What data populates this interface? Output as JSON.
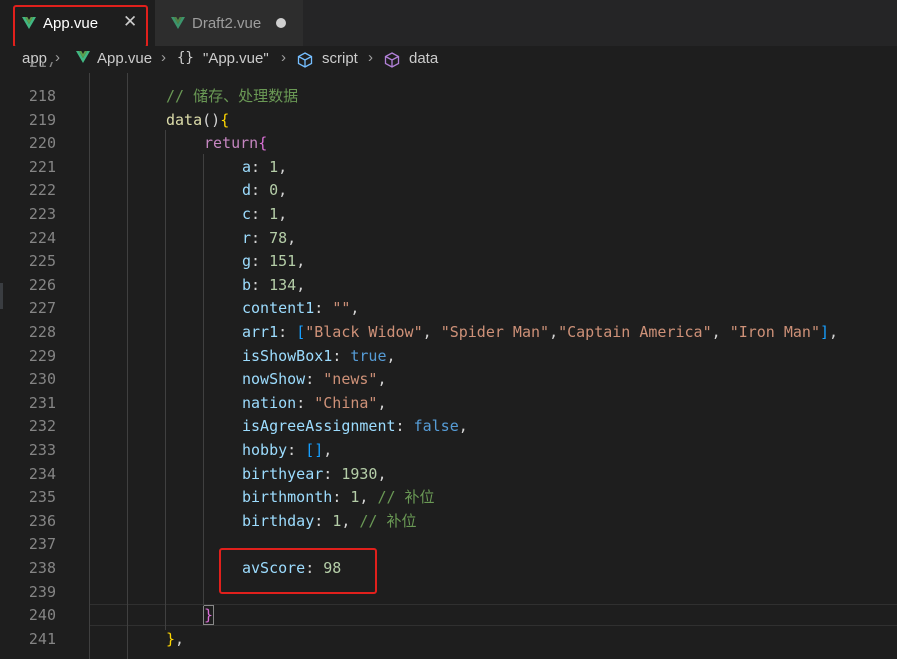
{
  "tabs": [
    {
      "label": "App.vue",
      "icon": "vue-icon",
      "active": true,
      "close_glyph": "✕"
    },
    {
      "label": "Draft2.vue",
      "icon": "vue-icon",
      "active": false,
      "unsaved": true
    }
  ],
  "breadcrumb": {
    "root": "app",
    "file": "App.vue",
    "braces": "{}",
    "object": "\"App.vue\"",
    "section": "script",
    "member": "data"
  },
  "editor": {
    "first_partial_line": "217",
    "lines": [
      {
        "n": "218",
        "comment": "// 储存、处理数据"
      },
      {
        "n": "219",
        "fn": "data",
        "paren": "()",
        "brace": "{"
      },
      {
        "n": "220",
        "kw": "return",
        "brace": "{"
      },
      {
        "n": "221",
        "key": "a",
        "val": "1",
        "type": "num"
      },
      {
        "n": "222",
        "key": "d",
        "val": "0",
        "type": "num"
      },
      {
        "n": "223",
        "key": "c",
        "val": "1",
        "type": "num"
      },
      {
        "n": "224",
        "key": "r",
        "val": "78",
        "type": "num"
      },
      {
        "n": "225",
        "key": "g",
        "val": "151",
        "type": "num"
      },
      {
        "n": "226",
        "key": "b",
        "val": "134",
        "type": "num"
      },
      {
        "n": "227",
        "key": "content1",
        "val": "\"\"",
        "type": "str"
      },
      {
        "n": "228",
        "key": "arr1",
        "items": [
          "\"Black Widow\"",
          "\"Spider Man\"",
          "\"Captain America\"",
          "\"Iron Man\""
        ]
      },
      {
        "n": "229",
        "key": "isShowBox1",
        "val": "true",
        "type": "bool"
      },
      {
        "n": "230",
        "key": "nowShow",
        "val": "\"news\"",
        "type": "str"
      },
      {
        "n": "231",
        "key": "nation",
        "val": "\"China\"",
        "type": "str"
      },
      {
        "n": "232",
        "key": "isAgreeAssignment",
        "val": "false",
        "type": "bool"
      },
      {
        "n": "233",
        "key": "hobby",
        "val": "[]",
        "type": "arr"
      },
      {
        "n": "234",
        "key": "birthyear",
        "val": "1930",
        "type": "num"
      },
      {
        "n": "235",
        "key": "birthmonth",
        "val": "1",
        "type": "num",
        "comment": "// 补位"
      },
      {
        "n": "236",
        "key": "birthday",
        "val": "1",
        "type": "num",
        "comment": "// 补位"
      },
      {
        "n": "237"
      },
      {
        "n": "238",
        "key": "avScore",
        "val": "98",
        "type": "num",
        "last": true
      },
      {
        "n": "239"
      },
      {
        "n": "240",
        "close": "}"
      },
      {
        "n": "241",
        "close": "},"
      }
    ]
  },
  "colors": {
    "annotation": "#e0201c",
    "vue_green": "#41b883",
    "vue_dark": "#35495e"
  }
}
